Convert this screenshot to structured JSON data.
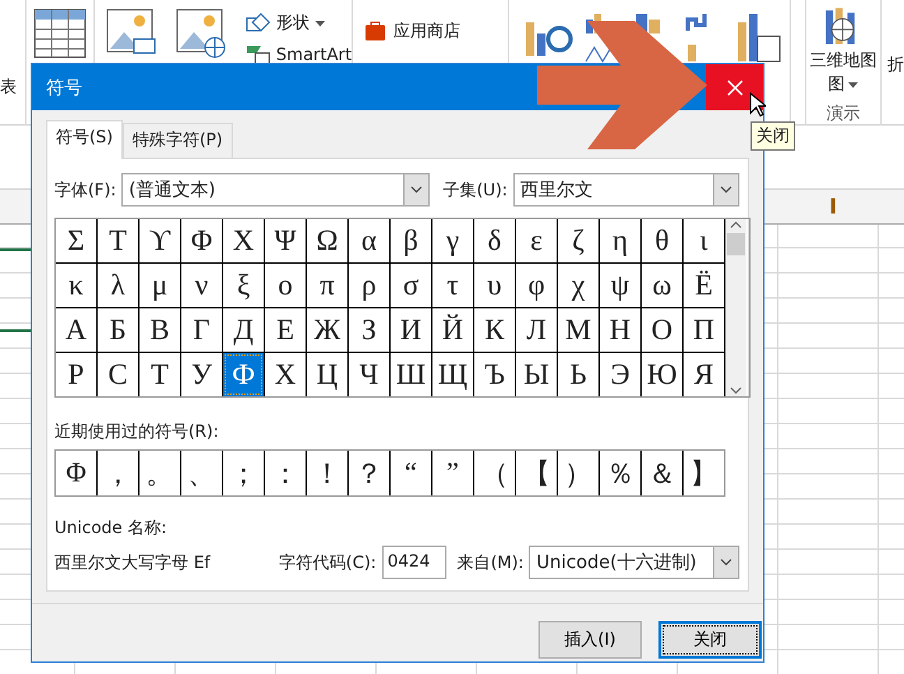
{
  "ribbon": {
    "left_label": "表",
    "shapes": "形状",
    "smartart": "SmartArt",
    "store": "应用商店",
    "map_label": "三维地图",
    "map_sub": "图",
    "group_label": "演示",
    "cut_label": "折"
  },
  "sheet": {
    "column_header": "I"
  },
  "dialog": {
    "title": "符号",
    "tabs": [
      {
        "label": "符号(S)",
        "selected": true
      },
      {
        "label": "特殊字符(P)",
        "selected": false
      }
    ],
    "font_label": "字体(F):",
    "font_value": "(普通文本)",
    "subset_label": "子集(U):",
    "subset_value": "西里尔文",
    "symbol_grid": {
      "cells": [
        {
          "char": "Σ",
          "selected": false
        },
        {
          "char": "Τ",
          "selected": false
        },
        {
          "char": "ϒ",
          "selected": false
        },
        {
          "char": "Φ",
          "selected": false
        },
        {
          "char": "Χ",
          "selected": false
        },
        {
          "char": "Ψ",
          "selected": false
        },
        {
          "char": "Ω",
          "selected": false
        },
        {
          "char": "α",
          "selected": false
        },
        {
          "char": "β",
          "selected": false
        },
        {
          "char": "γ",
          "selected": false
        },
        {
          "char": "δ",
          "selected": false
        },
        {
          "char": "ε",
          "selected": false
        },
        {
          "char": "ζ",
          "selected": false
        },
        {
          "char": "η",
          "selected": false
        },
        {
          "char": "θ",
          "selected": false
        },
        {
          "char": "ι",
          "selected": false
        },
        {
          "char": "κ",
          "selected": false
        },
        {
          "char": "λ",
          "selected": false
        },
        {
          "char": "μ",
          "selected": false
        },
        {
          "char": "ν",
          "selected": false
        },
        {
          "char": "ξ",
          "selected": false
        },
        {
          "char": "ο",
          "selected": false
        },
        {
          "char": "π",
          "selected": false
        },
        {
          "char": "ρ",
          "selected": false
        },
        {
          "char": "σ",
          "selected": false
        },
        {
          "char": "τ",
          "selected": false
        },
        {
          "char": "υ",
          "selected": false
        },
        {
          "char": "φ",
          "selected": false
        },
        {
          "char": "χ",
          "selected": false
        },
        {
          "char": "ψ",
          "selected": false
        },
        {
          "char": "ω",
          "selected": false
        },
        {
          "char": "Ё",
          "selected": false
        },
        {
          "char": "А",
          "selected": false
        },
        {
          "char": "Б",
          "selected": false
        },
        {
          "char": "В",
          "selected": false
        },
        {
          "char": "Г",
          "selected": false
        },
        {
          "char": "Д",
          "selected": false
        },
        {
          "char": "Е",
          "selected": false
        },
        {
          "char": "Ж",
          "selected": false
        },
        {
          "char": "З",
          "selected": false
        },
        {
          "char": "И",
          "selected": false
        },
        {
          "char": "Й",
          "selected": false
        },
        {
          "char": "К",
          "selected": false
        },
        {
          "char": "Л",
          "selected": false
        },
        {
          "char": "М",
          "selected": false
        },
        {
          "char": "Н",
          "selected": false
        },
        {
          "char": "О",
          "selected": false
        },
        {
          "char": "П",
          "selected": false
        },
        {
          "char": "Р",
          "selected": false
        },
        {
          "char": "С",
          "selected": false
        },
        {
          "char": "Т",
          "selected": false
        },
        {
          "char": "У",
          "selected": false
        },
        {
          "char": "Ф",
          "selected": true
        },
        {
          "char": "Х",
          "selected": false
        },
        {
          "char": "Ц",
          "selected": false
        },
        {
          "char": "Ч",
          "selected": false
        },
        {
          "char": "Ш",
          "selected": false
        },
        {
          "char": "Щ",
          "selected": false
        },
        {
          "char": "Ъ",
          "selected": false
        },
        {
          "char": "Ы",
          "selected": false
        },
        {
          "char": "Ь",
          "selected": false
        },
        {
          "char": "Э",
          "selected": false
        },
        {
          "char": "Ю",
          "selected": false
        },
        {
          "char": "Я",
          "selected": false
        }
      ]
    },
    "recent_label": "近期使用过的符号(R):",
    "recent": [
      "Φ",
      "，",
      "。",
      "、",
      "；",
      "：",
      "！",
      "？",
      "“",
      "”",
      "（",
      "【",
      "）",
      "％",
      "＆",
      "】"
    ],
    "unicode_name_label": "Unicode 名称:",
    "unicode_name": "西里尔文大写字母 Ef",
    "code_label": "字符代码(C):",
    "code_value": "0424",
    "from_label": "来自(M):",
    "from_value": "Unicode(十六进制)",
    "buttons": [
      {
        "label": "插入(I)",
        "default": false
      },
      {
        "label": "关闭",
        "default": true
      }
    ]
  },
  "tooltip": "关闭"
}
